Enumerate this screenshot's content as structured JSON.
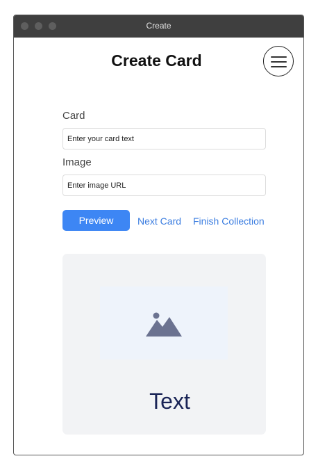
{
  "window": {
    "title": "Create"
  },
  "header": {
    "title": "Create Card",
    "menu_icon": "hamburger-menu-icon"
  },
  "form": {
    "card_label": "Card",
    "card_placeholder": "Enter your card text",
    "card_value": "",
    "image_label": "Image",
    "image_placeholder": "Enter image URL",
    "image_value": ""
  },
  "actions": {
    "preview_label": "Preview",
    "next_card_label": "Next Card",
    "finish_collection_label": "Finish Collection"
  },
  "preview": {
    "image_icon": "image-placeholder-icon",
    "text": "Text"
  },
  "colors": {
    "titlebar": "#3f3f3f",
    "accent": "#3d86f4",
    "link": "#3b7de0",
    "preview_background": "#f2f3f5",
    "image_placeholder_background": "#eef3fb",
    "image_icon": "#6b7290",
    "card_text": "#1a2456"
  }
}
